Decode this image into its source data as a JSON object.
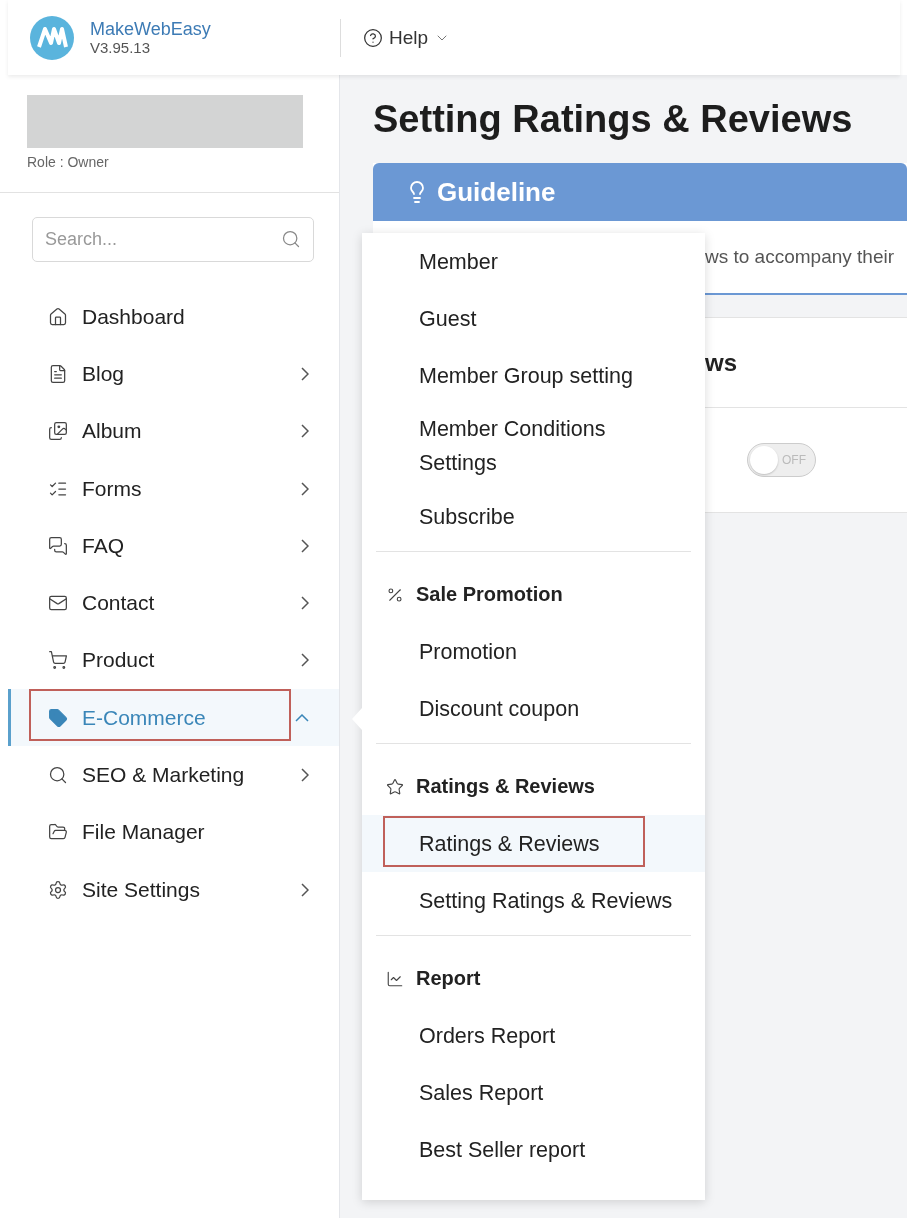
{
  "app": {
    "name": "MakeWebEasy",
    "version": "V3.95.13"
  },
  "header": {
    "help": "Help"
  },
  "account": {
    "role": "Role : Owner"
  },
  "search": {
    "placeholder": "Search..."
  },
  "sidebar": {
    "items": [
      {
        "label": "Dashboard",
        "selected": false,
        "outlined": false,
        "has_submenu": false
      },
      {
        "label": "Blog",
        "selected": false,
        "outlined": false,
        "has_submenu": true,
        "expanded": false
      },
      {
        "label": "Album",
        "selected": false,
        "outlined": false,
        "has_submenu": true,
        "expanded": false
      },
      {
        "label": "Forms",
        "selected": false,
        "outlined": false,
        "has_submenu": true,
        "expanded": false
      },
      {
        "label": "FAQ",
        "selected": false,
        "outlined": false,
        "has_submenu": true,
        "expanded": false
      },
      {
        "label": "Contact",
        "selected": false,
        "outlined": false,
        "has_submenu": true,
        "expanded": false
      },
      {
        "label": "Product",
        "selected": false,
        "outlined": false,
        "has_submenu": true,
        "expanded": false
      },
      {
        "label": "E-Commerce",
        "selected": true,
        "outlined": true,
        "has_submenu": true,
        "expanded": true
      },
      {
        "label": "SEO & Marketing",
        "selected": false,
        "outlined": false,
        "has_submenu": true,
        "expanded": false
      },
      {
        "label": "File Manager",
        "selected": false,
        "outlined": false,
        "has_submenu": false
      },
      {
        "label": "Site Settings",
        "selected": false,
        "outlined": false,
        "has_submenu": true,
        "expanded": false
      }
    ]
  },
  "page": {
    "title": "Setting Ratings & Reviews"
  },
  "guideline": {
    "title": "Guideline",
    "text": "ws to accompany their"
  },
  "settings_card": {
    "heading": "ws",
    "switch": {
      "on": false,
      "label": "OFF"
    }
  },
  "flyout": {
    "groups": [
      {
        "items": [
          {
            "label": "Member",
            "selected": false,
            "outlined": false
          },
          {
            "label": "Guest",
            "selected": false,
            "outlined": false
          },
          {
            "label": "Member Group setting",
            "selected": false,
            "outlined": false
          },
          {
            "label": "Member Conditions Settings",
            "selected": false,
            "outlined": false
          },
          {
            "label": "Subscribe",
            "selected": false,
            "outlined": false
          }
        ]
      },
      {
        "title": "Sale Promotion",
        "items": [
          {
            "label": "Promotion",
            "selected": false,
            "outlined": false
          },
          {
            "label": "Discount coupon",
            "selected": false,
            "outlined": false
          }
        ]
      },
      {
        "title": "Ratings & Reviews",
        "items": [
          {
            "label": "Ratings & Reviews",
            "selected": true,
            "outlined": true
          },
          {
            "label": "Setting Ratings & Reviews",
            "selected": false,
            "outlined": false
          }
        ]
      },
      {
        "title": "Report",
        "items": [
          {
            "label": "Orders Report",
            "selected": false,
            "outlined": false
          },
          {
            "label": "Sales Report",
            "selected": false,
            "outlined": false
          },
          {
            "label": "Best Seller report",
            "selected": false,
            "outlined": false
          }
        ]
      }
    ]
  }
}
